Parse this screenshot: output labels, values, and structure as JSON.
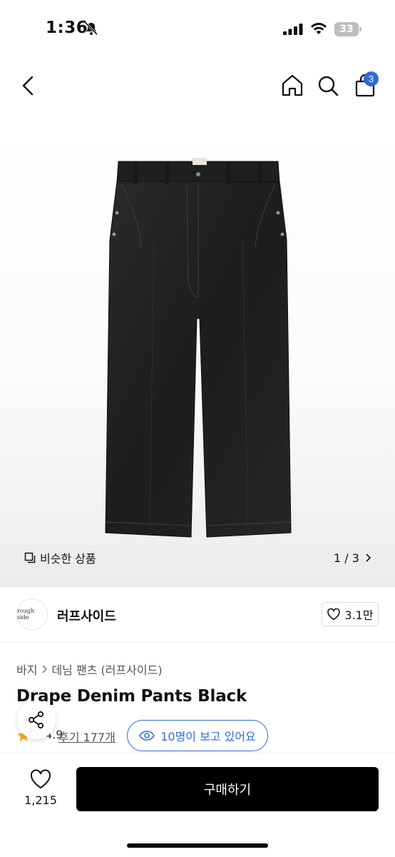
{
  "status_bar": {
    "time": "1:36",
    "battery": "33"
  },
  "nav": {
    "cart_count": "3"
  },
  "gallery": {
    "similar_label": "비슷한 상품",
    "pager": "1 / 3"
  },
  "brand": {
    "name": "러프사이드",
    "logo_text": "rough side",
    "likes": "3.1만"
  },
  "product": {
    "breadcrumb": [
      "바지",
      "데님 팬츠 (러프사이드)"
    ],
    "title": "Drape Denim Pants Black",
    "rating": "4.9",
    "review_label": "후기 177개",
    "viewers": "10명이 보고 있어요"
  },
  "bottom": {
    "wish_count": "1,215",
    "buy_label": "구매하기"
  },
  "colors": {
    "accent_blue": "#2f6bd8",
    "buy_button": "#000000",
    "rating_star": "#f5a623"
  }
}
